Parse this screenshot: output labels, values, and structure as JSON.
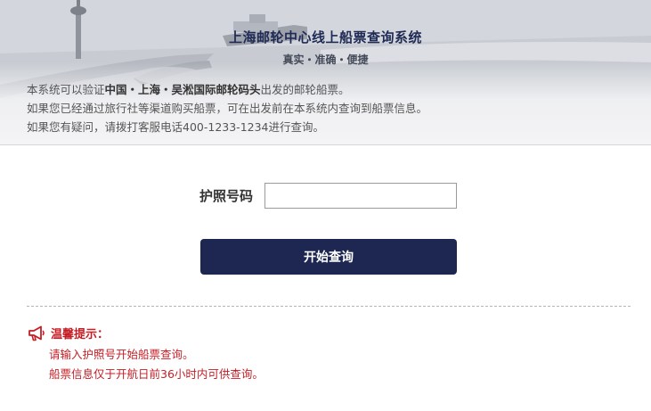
{
  "header": {
    "title": "上海邮轮中心线上船票查询系统",
    "tagline": "真实・准确・便捷"
  },
  "intro": {
    "line1_prefix": "本系统可以验证",
    "line1_bold": "中国・上海・吴淞国际邮轮码头",
    "line1_suffix": "出发的邮轮船票。",
    "line2": "如果您已经通过旅行社等渠道购买船票，可在出发前在本系统内查询到船票信息。",
    "line3": "如果您有疑问，请拨打客服电话400-1233-1234进行查询。"
  },
  "form": {
    "passport_label": "护照号码",
    "passport_value": "",
    "search_button_label": "开始查询"
  },
  "tips": {
    "icon": "megaphone-icon",
    "title": "温馨提示：",
    "items": [
      "请输入护照号开始船票查询。",
      "船票信息仅于开航日前36小时内可供查询。"
    ]
  },
  "colors": {
    "brand_navy": "#1e2752",
    "tip_red": "#c41d24"
  }
}
